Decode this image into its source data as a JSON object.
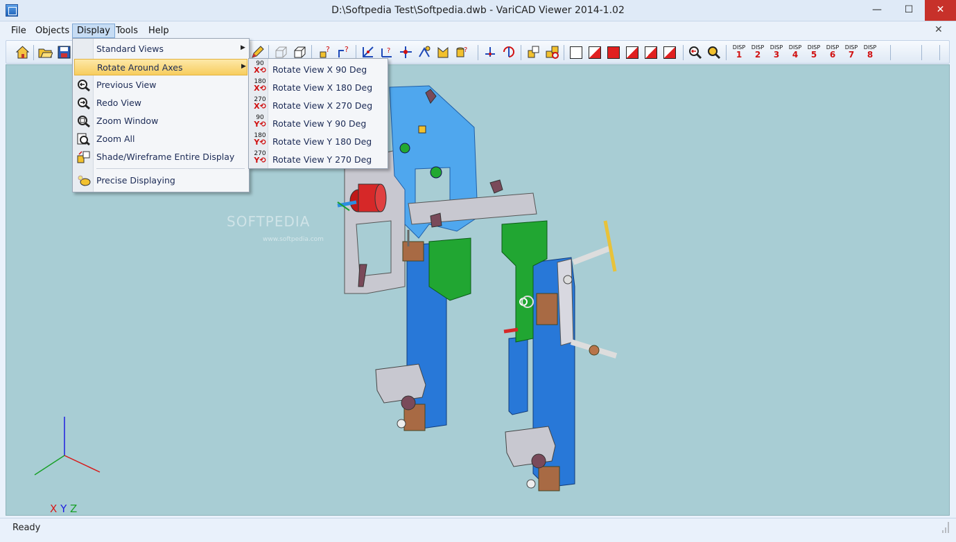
{
  "window": {
    "title": "D:\\Softpedia Test\\Softpedia.dwb - VariCAD Viewer 2014-1.02",
    "minimize": "—",
    "maximize": "☐",
    "close": "✕"
  },
  "menubar": {
    "items": [
      {
        "label": "File"
      },
      {
        "label": "Objects"
      },
      {
        "label": "Display"
      },
      {
        "label": "Tools"
      },
      {
        "label": "Help"
      }
    ],
    "mdi_close": "✕"
  },
  "toolbar": {
    "disp_buttons": [
      {
        "top": "DISP",
        "num": "1"
      },
      {
        "top": "DISP",
        "num": "2"
      },
      {
        "top": "DISP",
        "num": "3"
      },
      {
        "top": "DISP",
        "num": "4"
      },
      {
        "top": "DISP",
        "num": "5"
      },
      {
        "top": "DISP",
        "num": "6"
      },
      {
        "top": "DISP",
        "num": "7"
      },
      {
        "top": "DISP",
        "num": "8"
      }
    ]
  },
  "display_menu": {
    "items": [
      {
        "label": "Standard Views",
        "icon": "none",
        "submenu": true
      },
      {
        "label": "Rotate Around Axes",
        "icon": "none",
        "submenu": true,
        "highlighted": true
      },
      {
        "label": "Previous View",
        "icon": "zoom-previous-icon"
      },
      {
        "label": "Redo View",
        "icon": "zoom-redo-icon"
      },
      {
        "label": "Zoom Window",
        "icon": "zoom-window-icon"
      },
      {
        "label": "Zoom All",
        "icon": "zoom-all-icon"
      },
      {
        "label": "Shade/Wireframe Entire Display",
        "icon": "shade-wireframe-icon"
      },
      {
        "label": "Precise Displaying",
        "icon": "precise-display-icon"
      }
    ]
  },
  "rotate_menu": {
    "items": [
      {
        "label": "Rotate View X 90 Deg",
        "angle": "90",
        "axis": "X"
      },
      {
        "label": "Rotate View X 180 Deg",
        "angle": "180",
        "axis": "X"
      },
      {
        "label": "Rotate View X 270 Deg",
        "angle": "270",
        "axis": "X"
      },
      {
        "label": "Rotate View Y 90 Deg",
        "angle": "90",
        "axis": "Y"
      },
      {
        "label": "Rotate View Y 180 Deg",
        "angle": "180",
        "axis": "Y"
      },
      {
        "label": "Rotate View Y 270 Deg",
        "angle": "270",
        "axis": "Y"
      }
    ]
  },
  "canvas": {
    "background": "#a8cdd4",
    "axes": {
      "x": "X",
      "y": "Y",
      "z": "Z"
    },
    "watermark": "SOFTPEDIA",
    "watermark_url": "www.softpedia.com"
  },
  "status": {
    "text": "Ready"
  },
  "colors": {
    "menu_highlight": "#f7cd5e",
    "model_blue": "#3a8fe0",
    "model_green": "#21a632",
    "model_gray": "#c8c8d0"
  }
}
